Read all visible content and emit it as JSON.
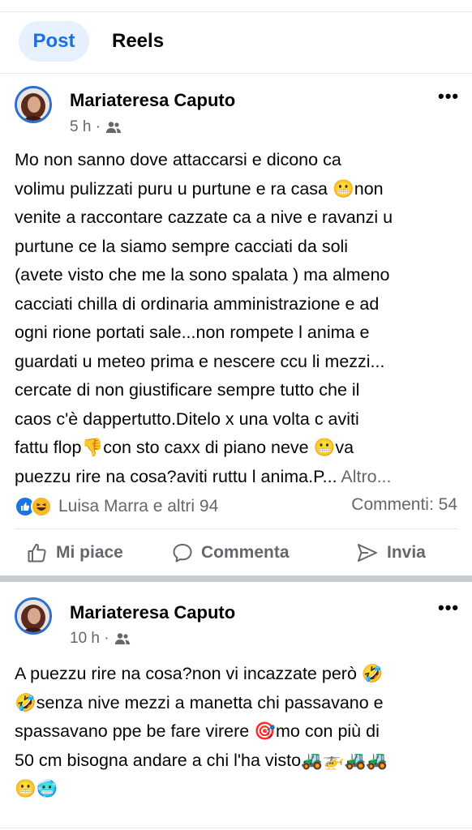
{
  "tabs": {
    "post": "Post",
    "reels": "Reels"
  },
  "post1": {
    "author": "Mariateresa Caputo",
    "time": "5 h ·",
    "lines": [
      "Mo non sanno dove attaccarsi e dicono ca",
      "volimu pulizzati puru u purtune e ra casa 😬non",
      "venite a raccontare cazzate ca a nive e ravanzi u",
      "purtune ce la siamo sempre cacciati da soli",
      "(avete visto che me la sono spalata ) ma almeno",
      "cacciati chilla di ordinaria amministrazione e  ad",
      "ogni rione portati sale...non rompete l anima e",
      "guardati u meteo prima e nescere ccu li mezzi...",
      "cercate di non giustificare sempre tutto che il",
      "caos c'è dappertutto.Ditelo x una volta c aviti",
      "fattu flop👎con sto caxx di piano neve 😬va"
    ],
    "last_line": "puezzu rire na cosa?aviti ruttu l anima.P...",
    "more_label": "Altro...",
    "reactions_text": "Luisa Marra e altri 94",
    "comments_text": "Commenti: 54",
    "actions": {
      "like": "Mi piace",
      "comment": "Commenta",
      "share": "Invia"
    }
  },
  "post2": {
    "author": "Mariateresa Caputo",
    "time": "10 h ·",
    "lines": [
      "A puezzu rire na cosa?non vi incazzate però 🤣",
      "🤣senza nive mezzi  a manetta chi passavano e",
      "spassavano ppe be fare virere 🎯mo con più di",
      "50 cm bisogna andare a chi l'ha visto🚜🚁🚜🚜",
      "😬🥶"
    ]
  },
  "colors": {
    "accent": "#1b6fe4",
    "tab_bg": "#e7f0fd",
    "secondary_text": "#65676b"
  },
  "icons": [
    "audience-friends-icon",
    "more-options-icon",
    "like-reaction-icon",
    "haha-reaction-icon",
    "thumbs-up-icon",
    "comment-bubble-icon",
    "send-icon"
  ]
}
